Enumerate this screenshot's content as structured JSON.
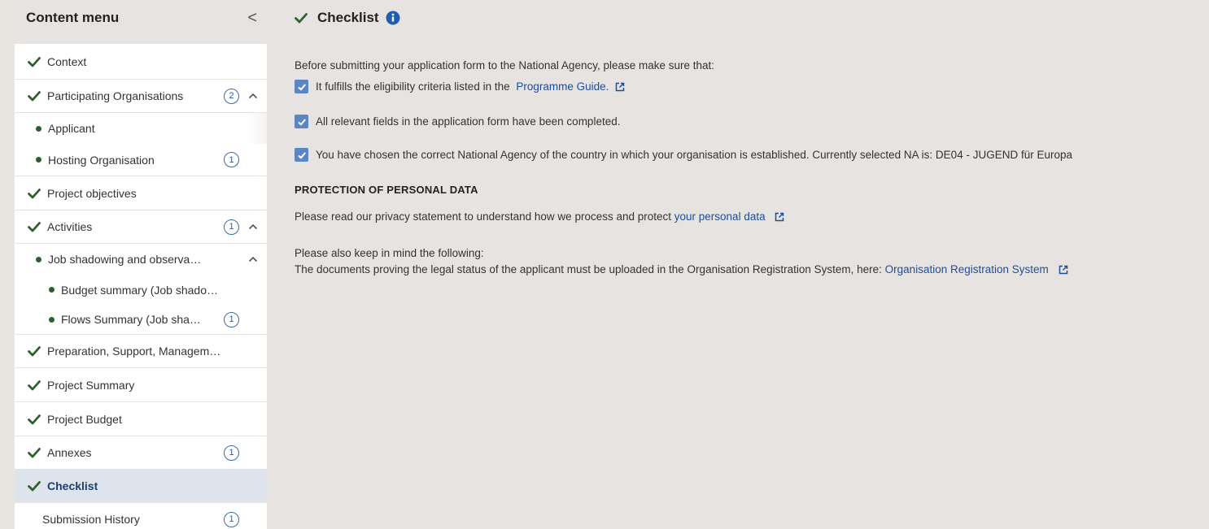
{
  "sidebar": {
    "title": "Content menu",
    "collapse_glyph": "<",
    "items": [
      {
        "label": "Context",
        "icon": "check",
        "level": 0
      },
      {
        "label": "Participating Organisations",
        "icon": "check",
        "level": 0,
        "badge": "2",
        "expanded": true
      },
      {
        "label": "Applicant",
        "icon": "dot",
        "level": 1
      },
      {
        "label": "Hosting Organisation",
        "icon": "dot",
        "level": 1,
        "badge": "1"
      },
      {
        "label": "Project objectives",
        "icon": "check",
        "level": 0
      },
      {
        "label": "Activities",
        "icon": "check",
        "level": 0,
        "badge": "1",
        "expanded": true
      },
      {
        "label": "Job shadowing and observa…",
        "icon": "dot",
        "level": 1,
        "expanded": true
      },
      {
        "label": "Budget summary (Job shado…",
        "icon": "dot",
        "level": 2
      },
      {
        "label": "Flows Summary (Job sha…",
        "icon": "dot",
        "level": 2,
        "badge": "1"
      },
      {
        "label": "Preparation, Support, Managem…",
        "icon": "check",
        "level": 0
      },
      {
        "label": "Project Summary",
        "icon": "check",
        "level": 0
      },
      {
        "label": "Project Budget",
        "icon": "check",
        "level": 0
      },
      {
        "label": "Annexes",
        "icon": "check",
        "level": 0,
        "badge": "1"
      },
      {
        "label": "Checklist",
        "icon": "check",
        "level": 0,
        "active": true
      },
      {
        "label": "Submission History",
        "icon": "none",
        "level": 0,
        "badge": "1"
      }
    ]
  },
  "main": {
    "title": "Checklist",
    "intro": "Before submitting your application form to the National Agency, please make sure that:",
    "checks": [
      {
        "text": "It fulfills the eligibility criteria listed in the ",
        "link": "Programme Guide.",
        "checked": true
      },
      {
        "text": "All relevant fields in the application form have been completed.",
        "link": "",
        "checked": true
      },
      {
        "text": "You have chosen the correct National Agency of the country in which your organisation is established. Currently selected NA is: DE04 - JUGEND für Europa",
        "link": "",
        "checked": true
      }
    ],
    "privacy_heading": "PROTECTION OF PERSONAL DATA",
    "privacy_text": "Please read our privacy statement to understand how we process and protect ",
    "privacy_link": "your personal data",
    "keep_in_mind": "Please also keep in mind the following:",
    "documents_text": "The documents proving the legal status of the applicant must be uploaded in the Organisation Registration System, here: ",
    "documents_link": "Organisation Registration System"
  },
  "colors": {
    "accent": "#2e5f2e",
    "link": "#1d4e9a",
    "checkbox": "#5b86c3",
    "active_bg": "#dde4ec",
    "info": "#1f5fb0"
  }
}
